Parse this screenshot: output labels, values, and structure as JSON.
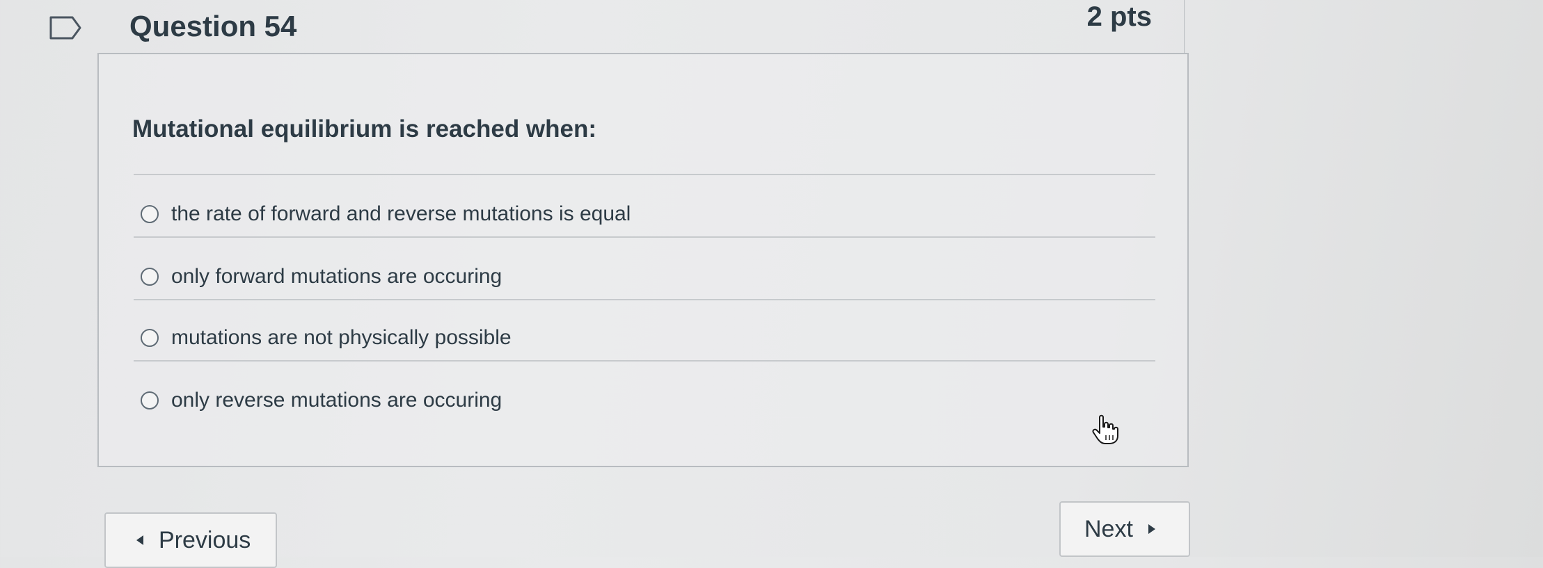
{
  "question": {
    "title": "Question 54",
    "points": "2 pts",
    "text": "Mutational equilibrium is reached when:",
    "answers": [
      {
        "label": "the rate of forward and reverse mutations is equal",
        "selected": false
      },
      {
        "label": "only forward mutations are occuring",
        "selected": false
      },
      {
        "label": "mutations are not physically possible",
        "selected": false
      },
      {
        "label": "only reverse mutations are occuring",
        "selected": false
      }
    ]
  },
  "nav": {
    "previous_label": "Previous",
    "next_label": "Next"
  },
  "icons": {
    "flag": "bookmark-flag-icon",
    "cursor": "hand-pointer-icon",
    "prev": "triangle-left-icon",
    "next": "triangle-right-icon"
  }
}
